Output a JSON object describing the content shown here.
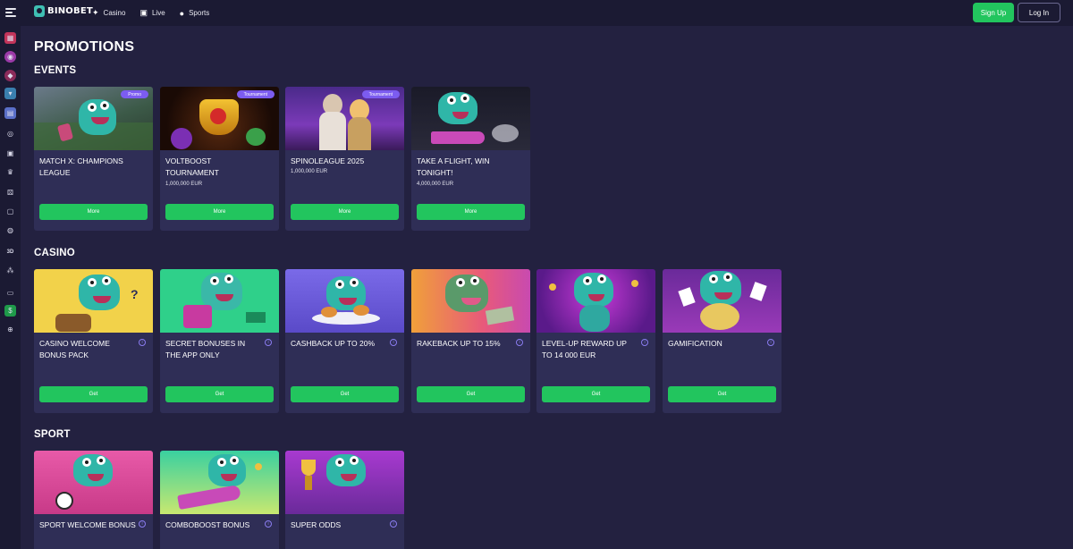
{
  "header": {
    "logo_text": "BINOBET",
    "nav": [
      {
        "label": "Casino",
        "icon": "casino-chip-icon"
      },
      {
        "label": "Live",
        "icon": "live-tv-icon"
      },
      {
        "label": "Sports",
        "icon": "soccer-ball-icon"
      }
    ],
    "signup_label": "Sign Up",
    "login_label": "Log In"
  },
  "sidebar": {
    "icons": [
      "gift-icon",
      "ball-icon",
      "rugby-ball-icon",
      "cup-icon",
      "tv-icon",
      "medal-icon",
      "box-icon",
      "crown-icon",
      "dice-icon",
      "slots-icon",
      "live-casino-icon",
      "3d-icon",
      "chips-icon",
      "chat-icon",
      "cash-icon",
      "globe-icon"
    ]
  },
  "page": {
    "title": "PROMOTIONS",
    "sections": {
      "events": {
        "title": "EVENTS",
        "cards": [
          {
            "title": "MATCH X: CHAMPIONS LEAGUE",
            "subtitle": "",
            "tag": "Promo",
            "button": "More"
          },
          {
            "title": "VOLTBOOST TOURNAMENT",
            "subtitle": "1,000,000 EUR",
            "tag": "Tournament",
            "button": "More"
          },
          {
            "title": "SPINOLEAGUE 2025",
            "subtitle": "1,000,000 EUR",
            "tag": "Tournament",
            "button": "More"
          },
          {
            "title": "TAKE A FLIGHT, WIN TONIGHT!",
            "subtitle": "4,000,000 EUR",
            "tag": "",
            "button": "More"
          }
        ]
      },
      "casino": {
        "title": "CASINO",
        "cards": [
          {
            "title": "CASINO WELCOME BONUS PACK",
            "button": "Get"
          },
          {
            "title": "SECRET BONUSES IN THE APP ONLY",
            "button": "Get"
          },
          {
            "title": "CASHBACK UP TO 20%",
            "button": "Get"
          },
          {
            "title": "RAKEBACK UP TO 15%",
            "button": "Get"
          },
          {
            "title": "LEVEL-UP REWARD UP TO 14 000 EUR",
            "button": "Get"
          },
          {
            "title": "GAMIFICATION",
            "button": "Get"
          }
        ]
      },
      "sport": {
        "title": "SPORT",
        "cards": [
          {
            "title": "SPORT WELCOME BONUS"
          },
          {
            "title": "COMBOBOOST BONUS"
          },
          {
            "title": "SUPER ODDS"
          }
        ]
      }
    }
  },
  "colors": {
    "background": "#232140",
    "topbar": "#1b1a33",
    "card": "#2f2e56",
    "accent_green": "#22c55e",
    "tag_purple": "#7c5cf0"
  }
}
